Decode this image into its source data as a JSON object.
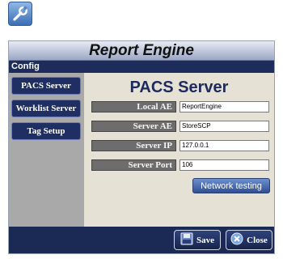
{
  "app_icon": {
    "icon": "wrench-icon"
  },
  "window": {
    "title": "Report Engine",
    "section": "Config"
  },
  "sidebar": {
    "items": [
      {
        "label": "PACS Server"
      },
      {
        "label": "Worklist Server"
      },
      {
        "label": "Tag Setup"
      }
    ]
  },
  "content": {
    "title": "PACS Server",
    "fields": [
      {
        "label": "Local AE",
        "value": "ReportEngine"
      },
      {
        "label": "Server AE",
        "value": "StoreSCP"
      },
      {
        "label": "Server IP",
        "value": "127.0.0.1"
      },
      {
        "label": "Server Port",
        "value": "106"
      }
    ],
    "network_button": "Network testing"
  },
  "footer": {
    "save_label": "Save",
    "save_icon": "floppy-disk-icon",
    "close_label": "Close",
    "close_icon": "close-globe-icon"
  }
}
